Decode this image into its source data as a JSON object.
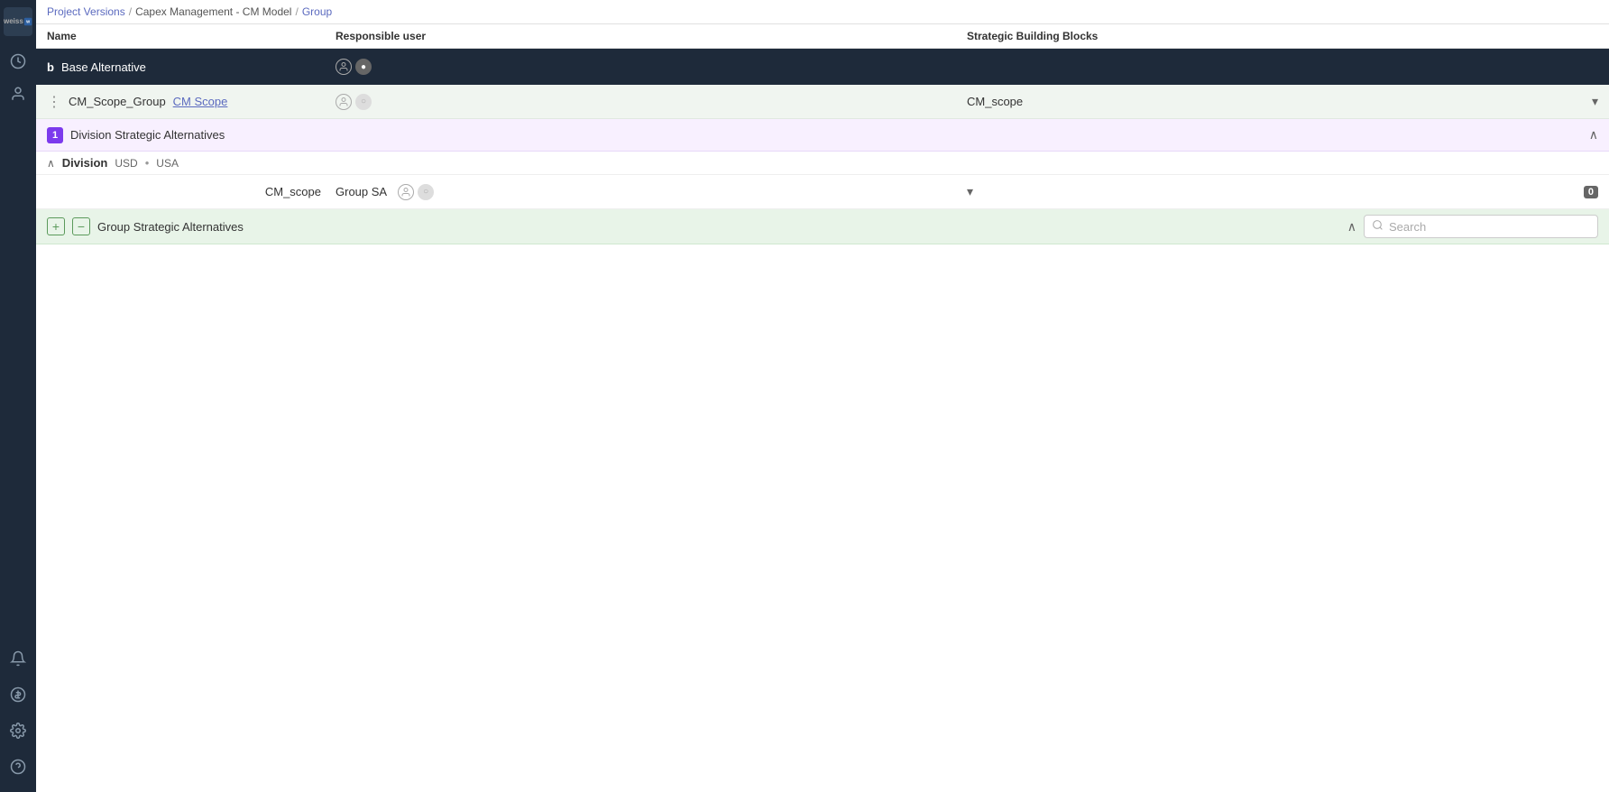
{
  "sidebar": {
    "logo": "weiss",
    "icons": [
      {
        "name": "clock-icon",
        "symbol": "🕐"
      },
      {
        "name": "user-icon",
        "symbol": "👤"
      }
    ],
    "bottom_icons": [
      {
        "name": "bell-icon",
        "symbol": "🔔"
      },
      {
        "name": "dollar-icon",
        "symbol": "💲"
      },
      {
        "name": "settings-icon",
        "symbol": "⚙"
      },
      {
        "name": "help-icon",
        "symbol": "❓"
      }
    ]
  },
  "breadcrumb": {
    "items": [
      {
        "label": "Project Versions",
        "link": true
      },
      {
        "label": "/",
        "link": false
      },
      {
        "label": "Capex Management - CM Model",
        "link": false
      },
      {
        "label": "/",
        "link": false
      },
      {
        "label": "Group",
        "link": true
      }
    ]
  },
  "columns": {
    "name": "Name",
    "responsible": "Responsible user",
    "strategic": "Strategic Building Blocks"
  },
  "base_row": {
    "letter": "b",
    "name": "Base Alternative",
    "toggle1": "off",
    "toggle2": "on"
  },
  "group_row": {
    "dots": "⋮",
    "group_name": "CM_Scope_Group",
    "link_label": "CM Scope",
    "toggle1": "off",
    "toggle2": "off",
    "strategic_value": "CM_scope"
  },
  "division_sa_section": {
    "badge": "1",
    "label": "Division Strategic Alternatives"
  },
  "division_header": {
    "label": "Division",
    "currency": "USD",
    "bullet": "•",
    "region": "USA"
  },
  "cm_scope_row": {
    "name": "CM_scope",
    "group_sa_name": "Group SA",
    "toggle1": "off",
    "toggle2": "off",
    "zero_badge": "0"
  },
  "group_sa_section": {
    "label": "Group Strategic Alternatives",
    "search_placeholder": "Search"
  }
}
